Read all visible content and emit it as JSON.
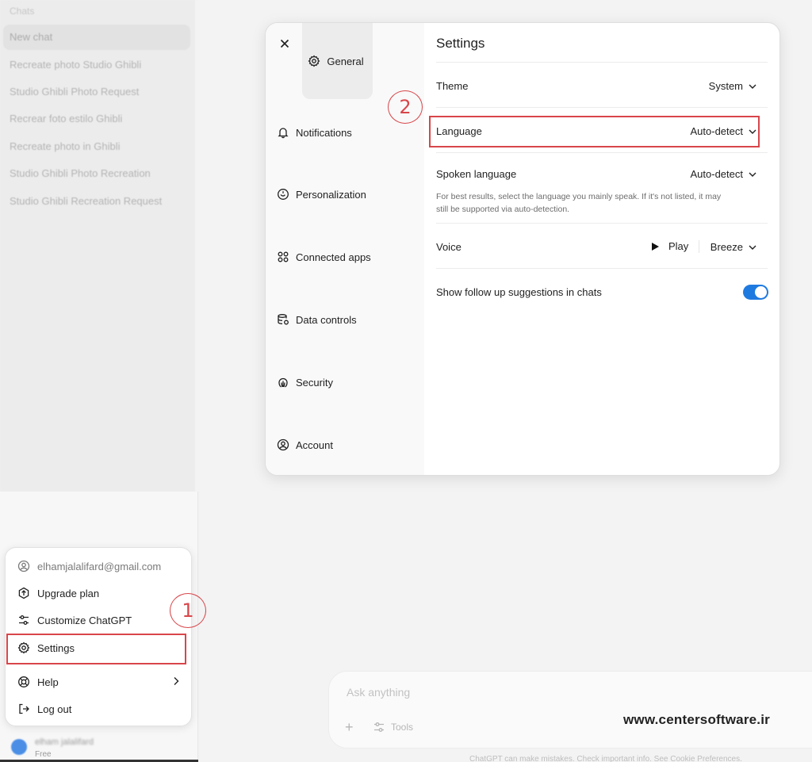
{
  "sidebar": {
    "section_label": "Chats",
    "chats": [
      "New chat",
      "Recreate photo Studio Ghibli",
      "Studio Ghibli Photo Request",
      "Recrear foto estilo Ghibli",
      "Recreate photo in Ghibli",
      "Studio Ghibli Photo Recreation",
      "Studio Ghibli Recreation Request"
    ]
  },
  "account_menu": {
    "email": "elhamjalalifard@gmail.com",
    "items": [
      "Upgrade plan",
      "Customize ChatGPT",
      "Settings",
      "Help",
      "Log out"
    ],
    "user_name": "elham jalalifard",
    "user_plan": "Free"
  },
  "callouts": [
    "1",
    "2"
  ],
  "settings": {
    "title": "Settings",
    "nav": [
      "General",
      "Notifications",
      "Personalization",
      "Connected apps",
      "Data controls",
      "Security",
      "Account"
    ],
    "theme_label": "Theme",
    "theme_value": "System",
    "language_label": "Language",
    "language_value": "Auto-detect",
    "spoken_label": "Spoken language",
    "spoken_value": "Auto-detect",
    "spoken_help": "For best results, select the language you mainly speak. If it's not listed, it may still be supported via auto-detection.",
    "voice_label": "Voice",
    "voice_play": "Play",
    "voice_value": "Breeze",
    "followup_label": "Show follow up suggestions in chats",
    "followup_enabled": true
  },
  "composer": {
    "placeholder": "Ask anything",
    "tools_label": "Tools",
    "disclaimer": "ChatGPT can make mistakes. Check important info. See Cookie Preferences."
  },
  "watermark": "www.centersoftware.ir",
  "colors": {
    "highlight": "#d8464a",
    "toggle_on": "#1f7ae0"
  }
}
